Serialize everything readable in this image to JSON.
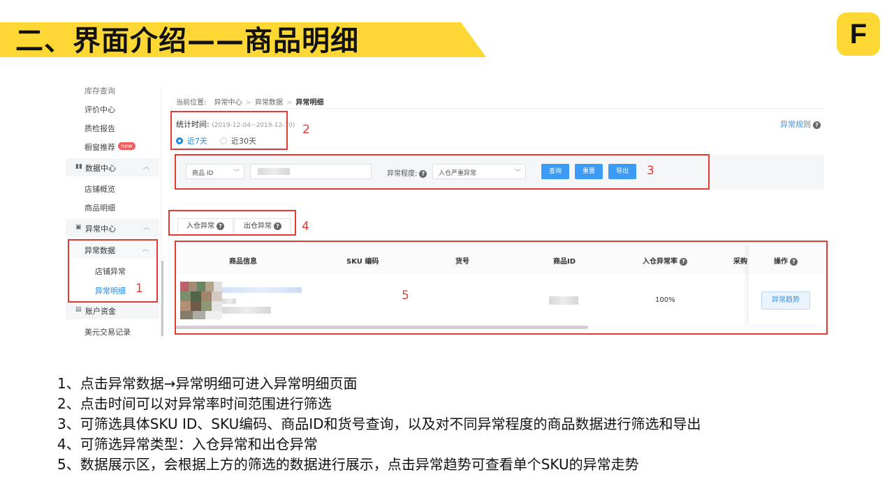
{
  "title": "二、界面介绍——商品明细",
  "logo_letter": "F",
  "sidebar": {
    "items_top": [
      "库存查询",
      "评价中心",
      "质检报告",
      "橱窗推荐"
    ],
    "new_badge": "new",
    "group_data": "数据中心",
    "data_items": [
      "店铺概览",
      "商品明细"
    ],
    "group_abnormal": "异常中心",
    "sub_group": "异常数据",
    "sub_items": [
      "店铺异常",
      "异常明细"
    ],
    "group_account": "账户资金",
    "account_items": [
      "美元交易记录"
    ]
  },
  "breadcrumb": {
    "prefix": "当前位置:",
    "level1": "异常中心",
    "level2": "异常数据",
    "current": "异常明细"
  },
  "stat": {
    "label": "统计时间:",
    "range": "(2019-12-04~2019-12-10)",
    "opt7": "近7天",
    "opt30": "近30天"
  },
  "rules_link": "异常规则",
  "filter": {
    "field_select": "商品 ID",
    "degree_label": "异常程度:",
    "degree_value": "入仓严重异常",
    "btn_query": "查询",
    "btn_reset": "重置",
    "btn_export": "导出"
  },
  "tabs": [
    "入仓异常",
    "出仓异常"
  ],
  "table": {
    "headers": [
      "商品信息",
      "SKU 编码",
      "货号",
      "商品ID",
      "入仓异常率",
      "采购",
      "操作"
    ],
    "row": {
      "rate": "100%",
      "action": "异常趋势"
    }
  },
  "annotations": [
    "1",
    "2",
    "3",
    "4",
    "5"
  ],
  "notes": [
    "1、点击异常数据→异常明细可进入异常明细页面",
    "2、点击时间可以对异常率时间范围进行筛选",
    "3、可筛选具体SKU ID、SKU编码、商品ID和货号查询，以及对不同异常程度的商品数据进行筛选和导出",
    "4、可筛选异常类型：入仓异常和出仓异常",
    "5、数据展示区，会根据上方的筛选的数据进行展示，点击异常趋势可查看单个SKU的异常走势"
  ],
  "colors": {
    "banner": "#fdd835",
    "accent": "#3b9bf5",
    "annotation": "#e53935"
  }
}
